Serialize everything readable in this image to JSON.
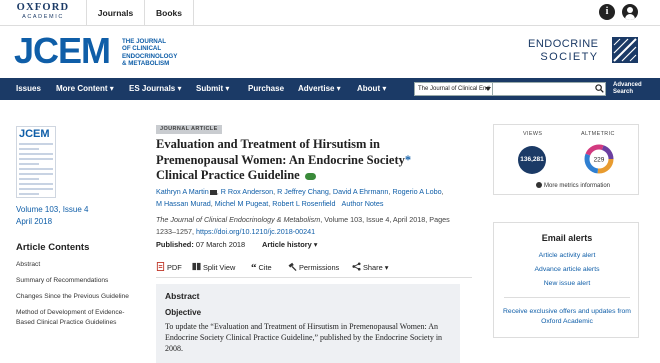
{
  "topbar": {
    "brand_line1": "OXFORD",
    "brand_line2": "ACADEMIC",
    "journals_label": "Journals",
    "books_label": "Books",
    "info_icon": "info-icon",
    "account_icon": "account-icon"
  },
  "header": {
    "journal_abbrev": "JCEM",
    "journal_full": [
      "THE JOURNAL",
      "OF CLINICAL",
      "ENDOCRINOLOGY",
      "& METABOLISM"
    ],
    "society_line1": "ENDOCRINE",
    "society_line2": "SOCIETY"
  },
  "nav": {
    "items": [
      "Issues",
      "More Content ▾",
      "ES Journals ▾",
      "Submit ▾",
      "Purchase",
      "Advertise ▾",
      "About ▾"
    ],
    "search_scope": "The Journal of Clinical End",
    "search_placeholder": "",
    "advanced_line1": "Advanced",
    "advanced_line2": "Search"
  },
  "sidebar": {
    "cover_title": "JCEM",
    "volume": "Volume 103, Issue 4",
    "date": "April 2018",
    "contents_heading": "Article Contents",
    "toc": [
      "Abstract",
      "Summary of Recommendations",
      "Changes Since the Previous Guideline",
      "Method of Development of Evidence-Based Clinical Practice Guidelines"
    ]
  },
  "article": {
    "type_badge": "JOURNAL ARTICLE",
    "title_text": "Evaluation and Treatment of Hirsutism in Premenopausal Women: An Endocrine Society",
    "title_star": "*",
    "title_tail": "Clinical Practice Guideline",
    "authors": [
      "Kathryn A Martin",
      "R Rox Anderson",
      "R Jeffrey Chang",
      "David A Ehrmann",
      "Rogerio A Lobo",
      "M Hassan Murad",
      "Michel M Pugeat",
      "Robert L Rosenfield",
      "Author Notes"
    ],
    "citation_journal": "The Journal of Clinical Endocrinology & Metabolism",
    "citation_rest": ", Volume 103, Issue 4, April 2018, Pages 1233–1257,",
    "doi": "https://doi.org/10.1210/jc.2018-00241",
    "published_label": "Published:",
    "published_date": "07 March 2018",
    "history_label": "Article history ▾",
    "tools": [
      "PDF",
      "Split View",
      "Cite",
      "Permissions",
      "Share ▾"
    ]
  },
  "abstract": {
    "heading": "Abstract",
    "subheading": "Objective",
    "text": "To update the “Evaluation and Treatment of Hirsutism in Premenopausal Women: An Endocrine Society Clinical Practice Guideline,” published by the Endocrine Society in 2008."
  },
  "metrics": {
    "views_label": "VIEWS",
    "views_value": "136,281",
    "altmetric_label": "ALTMETRIC",
    "altmetric_value": "229",
    "more_label": "More metrics information"
  },
  "alerts": {
    "heading": "Email alerts",
    "links": [
      "Article activity alert",
      "Advance article alerts",
      "New issue alert"
    ],
    "oup_link": "Receive exclusive offers and updates from Oxford Academic"
  },
  "colors": {
    "brand_blue": "#0f5ea8",
    "nav_navy": "#1b3a66",
    "abstract_bg": "#eef0f3"
  }
}
